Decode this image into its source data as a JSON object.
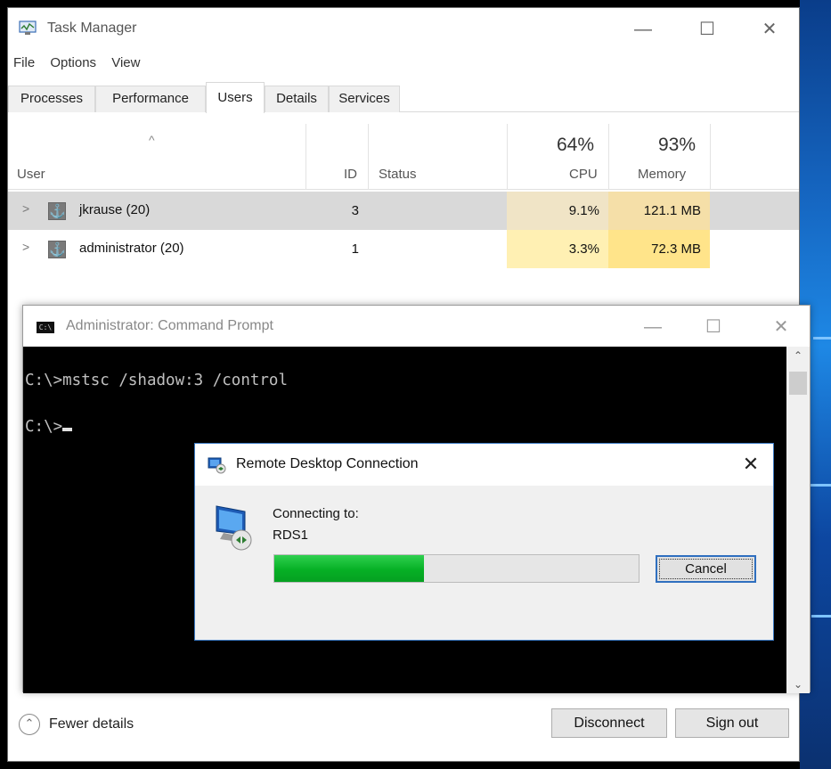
{
  "task_manager": {
    "title": "Task Manager",
    "window_controls": [
      "minimize",
      "maximize",
      "close"
    ],
    "menu": [
      "File",
      "Options",
      "View"
    ],
    "tabs": [
      {
        "label": "Processes",
        "active": false
      },
      {
        "label": "Performance",
        "active": false
      },
      {
        "label": "Users",
        "active": true
      },
      {
        "label": "Details",
        "active": false
      },
      {
        "label": "Services",
        "active": false
      }
    ],
    "columns": {
      "user": "User",
      "id": "ID",
      "status": "Status",
      "cpu_pct": "64%",
      "cpu": "CPU",
      "memory_pct": "93%",
      "memory": "Memory",
      "sort_indicator": "^"
    },
    "rows": [
      {
        "name": "jkrause (20)",
        "id": "3",
        "status": "",
        "cpu": "9.1%",
        "memory": "121.1 MB",
        "selected": true
      },
      {
        "name": "administrator (20)",
        "id": "1",
        "status": "",
        "cpu": "3.3%",
        "memory": "72.3 MB",
        "selected": false
      }
    ],
    "footer": {
      "fewer_details": "Fewer details",
      "disconnect": "Disconnect",
      "sign_out": "Sign out"
    }
  },
  "command_prompt": {
    "title": "Administrator: Command Prompt",
    "lines": [
      "C:\\>mstsc /shadow:3 /control",
      "C:\\>"
    ]
  },
  "rdc_dialog": {
    "title": "Remote Desktop Connection",
    "label": "Connecting to:",
    "host": "RDS1",
    "progress_fraction": 0.41,
    "cancel": "Cancel",
    "close": "✕"
  },
  "colors": {
    "cpu_heat_row1": "#f0e4c6",
    "mem_heat_row1": "#f5dfa8",
    "cpu_heat_row2": "#fff0b3",
    "mem_heat_row2": "#ffe48a",
    "progress_green": "#06b025",
    "dialog_border": "#3c7ac3"
  }
}
